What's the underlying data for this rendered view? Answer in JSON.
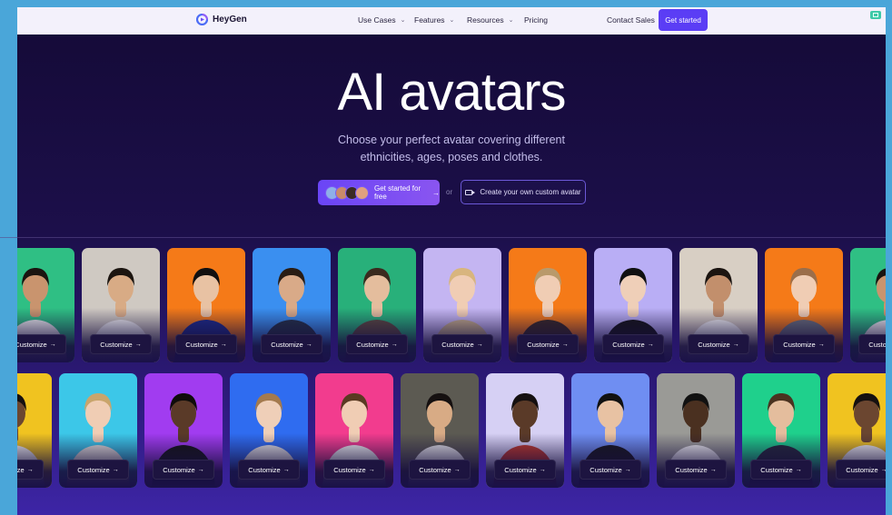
{
  "brand": {
    "name": "HeyGen"
  },
  "nav": {
    "items": [
      {
        "label": "Use Cases",
        "dropdown": true
      },
      {
        "label": "Features",
        "dropdown": true
      },
      {
        "label": "Resources",
        "dropdown": true
      },
      {
        "label": "Pricing",
        "dropdown": false
      }
    ],
    "contact_label": "Contact Sales",
    "cta_label": "Get started"
  },
  "hero": {
    "title": "AI avatars",
    "subtitle": "Choose your perfect avatar covering different ethnicities, ages, poses and clothes.",
    "primary_cta": "Get started for free",
    "or_text": "or",
    "secondary_cta": "Create your own custom avatar"
  },
  "card_label": "Customize",
  "row1": [
    {
      "bg": "#2fbf84",
      "skin": "#c9946e",
      "shirt": "#f2f2f2",
      "hair": "#1a1410"
    },
    {
      "bg": "#cfc9c2",
      "skin": "#d8ab85",
      "shirt": "#f5f5f5",
      "hair": "#1c1510"
    },
    {
      "bg": "#f57a18",
      "skin": "#e8c2a3",
      "shirt": "#1c2c8a",
      "hair": "#121010"
    },
    {
      "bg": "#3a8ff0",
      "skin": "#d9aa88",
      "shirt": "#243347",
      "hair": "#2a1d14"
    },
    {
      "bg": "#28b07a",
      "skin": "#e4bd9d",
      "shirt": "#5d4a3e",
      "hair": "#3a2a1e"
    },
    {
      "bg": "#c4b5f2",
      "skin": "#f0cdb4",
      "shirt": "#c8b08c",
      "hair": "#d8b57e"
    },
    {
      "bg": "#f57a18",
      "skin": "#f0cdb4",
      "shirt": "#3a2a22",
      "hair": "#b99a6b"
    },
    {
      "bg": "#b9aef5",
      "skin": "#efcfb8",
      "shirt": "#141414",
      "hair": "#101010"
    },
    {
      "bg": "#d8cfc4",
      "skin": "#c28f6c",
      "shirt": "#f5f5f5",
      "hair": "#1b1410"
    },
    {
      "bg": "#f57a18",
      "skin": "#f0cdb4",
      "shirt": "#6a6f7a",
      "hair": "#9b6e4a"
    },
    {
      "bg": "#2fbf84",
      "skin": "#c9946e",
      "shirt": "#f2f2f2",
      "hair": "#1a1410"
    }
  ],
  "row2": [
    {
      "bg": "#f0c320",
      "skin": "#6b4630",
      "shirt": "#f2f2f2",
      "hair": "#151010"
    },
    {
      "bg": "#3cc7e8",
      "skin": "#f0cdb4",
      "shirt": "#e8e4dc",
      "hair": "#c9a56c"
    },
    {
      "bg": "#a13cf0",
      "skin": "#5a3a28",
      "shirt": "#151515",
      "hair": "#0f0c0b"
    },
    {
      "bg": "#2f6cf0",
      "skin": "#efcfb8",
      "shirt": "#e8e8e8",
      "hair": "#a47a4e"
    },
    {
      "bg": "#f23c8e",
      "skin": "#f0cdb4",
      "shirt": "#f3f3f3",
      "hair": "#5a3a22"
    },
    {
      "bg": "#5c5a52",
      "skin": "#d8ab85",
      "shirt": "#e8e8e8",
      "hair": "#151010"
    },
    {
      "bg": "#d6d0f4",
      "skin": "#5a3a28",
      "shirt": "#c23a2a",
      "hair": "#151010"
    },
    {
      "bg": "#6f8ef2",
      "skin": "#e8c2a3",
      "shirt": "#18181c",
      "hair": "#111111"
    },
    {
      "bg": "#9a9a96",
      "skin": "#4a3020",
      "shirt": "#f2f2f2",
      "hair": "#111111"
    },
    {
      "bg": "#1fd08c",
      "skin": "#e4bd9d",
      "shirt": "#262a3a",
      "hair": "#4a3220"
    },
    {
      "bg": "#f0c320",
      "skin": "#6b4630",
      "shirt": "#f2f2f2",
      "hair": "#151010"
    }
  ]
}
